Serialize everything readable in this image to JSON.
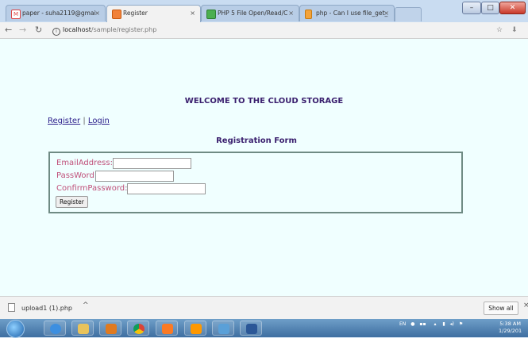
{
  "tabs": [
    {
      "label": "paper - suha2119@gmai",
      "favicon": "gmail-icon",
      "active": false
    },
    {
      "label": "Register",
      "favicon": "page-icon",
      "active": true
    },
    {
      "label": "PHP 5 File Open/Read/C",
      "favicon": "w3schools-icon",
      "active": false
    },
    {
      "label": "php - Can I use file_get_",
      "favicon": "stackoverflow-icon",
      "active": false
    }
  ],
  "tab_close_glyph": "×",
  "window_controls": {
    "minimize": "–",
    "maximize": "□",
    "close": "✕"
  },
  "address": {
    "host": "localhost",
    "path": "/sample/register.php"
  },
  "page": {
    "welcome": "WELCOME TO THE CLOUD STORAGE",
    "links": {
      "register": "Register",
      "separator": "|",
      "login": "Login"
    },
    "form_title": "Registration Form",
    "fields": [
      {
        "label": "EmailAddress:",
        "value": ""
      },
      {
        "label": "PassWord:",
        "value": ""
      },
      {
        "label": "ConfirmPassword:",
        "value": ""
      }
    ],
    "submit_label": "Register"
  },
  "downloads": {
    "file_name": "upload1 (1).php",
    "show_all": "Show all",
    "close": "×",
    "chevron": "^"
  },
  "taskbar": {
    "apps": [
      "explorer-icon",
      "ie-icon",
      "folder-icon",
      "outlook-icon",
      "chrome-icon",
      "xampp-icon",
      "sublime-icon",
      "network-icon",
      "word-icon"
    ],
    "tray_lang": "EN",
    "time": "5:38 AM",
    "date": "1/29/201"
  },
  "colors": {
    "page_bg": "#f0ffff",
    "heading": "#3a1f6e",
    "label": "#c0507a",
    "link": "#2a1c8a"
  }
}
